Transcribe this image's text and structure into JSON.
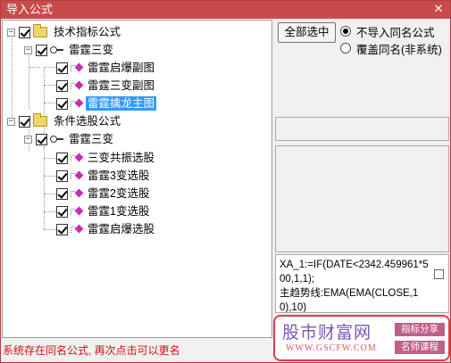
{
  "window": {
    "title": "导入公式",
    "close_glyph": "✕"
  },
  "tree": {
    "groups": [
      {
        "label": "技术指标公式",
        "expander": "−",
        "author": {
          "label": "雷霆三变",
          "expander": "−"
        },
        "items": [
          {
            "label": "雷霆启爆副图",
            "selected": false
          },
          {
            "label": "雷霆三变副图",
            "selected": false
          },
          {
            "label": "雷霆擒龙主图",
            "selected": true
          }
        ]
      },
      {
        "label": "条件选股公式",
        "expander": "−",
        "author": {
          "label": "雷霆三变",
          "expander": "−"
        },
        "items": [
          {
            "label": "三变共振选股",
            "selected": false
          },
          {
            "label": "雷霆3变选股",
            "selected": false
          },
          {
            "label": "雷霆2变选股",
            "selected": false
          },
          {
            "label": "雷霆1变选股",
            "selected": false
          },
          {
            "label": "雷霆启爆选股",
            "selected": false
          }
        ]
      }
    ]
  },
  "controls": {
    "select_all_label": "全部选中",
    "radio_options": [
      {
        "label": "不导入同名公式",
        "checked": true
      },
      {
        "label": "覆盖同名(非系统)",
        "checked": false
      }
    ]
  },
  "formula_preview": {
    "text": "XA_1:=IF(DATE<2342.459961*500,1,1);\n主趋势线:EMA(EMA(CLOSE,10),10)"
  },
  "status": {
    "message": "系统存在同名公式, 再次点击可以更名"
  },
  "watermark": {
    "name": "股市财富网",
    "url": "WWW.GSCFW.COM",
    "tag1": "指标分享",
    "tag2": "名师课程"
  },
  "colors": {
    "titlebar": "#c94a4a",
    "selection": "#3399ff",
    "status_text": "#d01010",
    "formula_icon": "#cc2bb8"
  }
}
